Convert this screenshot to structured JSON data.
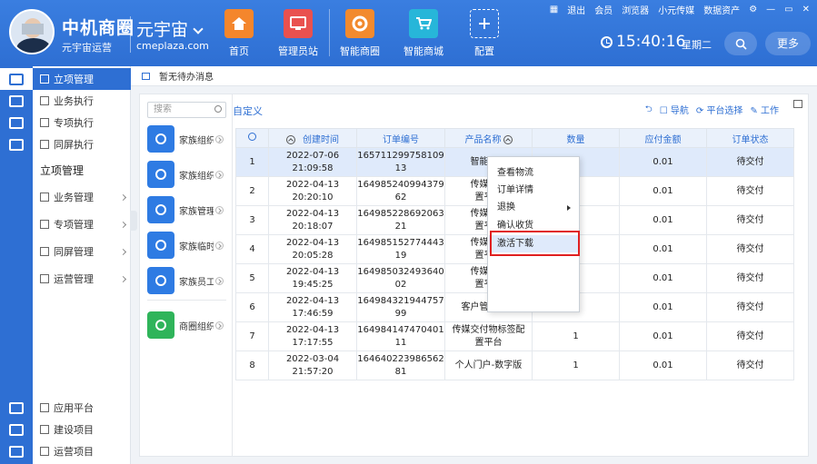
{
  "header": {
    "brand": "中机商圈",
    "brand_sub": "元宇宙运营",
    "workspace": "元宇宙",
    "workspace_url": "cmeplaza.com",
    "nav": [
      {
        "label": "首页",
        "icon": "home-icon"
      },
      {
        "label": "管理员站",
        "icon": "admin-station-icon"
      },
      {
        "label": "智能商圈",
        "icon": "smart-circle-icon"
      },
      {
        "label": "智能商城",
        "icon": "smart-mall-icon"
      },
      {
        "label": "配置",
        "icon": "plus-icon"
      }
    ],
    "toplinks": [
      "退出",
      "会员",
      "浏览器",
      "小元传媒",
      "数据资产"
    ],
    "time": "15:40:16",
    "weekday": "星期二",
    "more": "更多"
  },
  "sidebar": {
    "active": "立项管理",
    "items": [
      "立项管理",
      "业务执行",
      "专项执行",
      "同屏执行"
    ],
    "section": "立项管理",
    "groups": [
      "业务管理",
      "专项管理",
      "同屏管理",
      "运营管理"
    ],
    "bottom": [
      "应用平台",
      "建设项目",
      "运营项目"
    ]
  },
  "notice": "暂无待办消息",
  "orgs": {
    "search_placeholder": "搜索",
    "items": [
      {
        "label": "家族组织",
        "color": "#2e7be3"
      },
      {
        "label": "家族组织",
        "color": "#2e7be3"
      },
      {
        "label": "家族管理",
        "color": "#2e7be3"
      },
      {
        "label": "家族临时",
        "color": "#2e7be3"
      },
      {
        "label": "家族员工",
        "color": "#2e7be3"
      },
      {
        "label": "商圈组织",
        "color": "#2fb45a"
      }
    ]
  },
  "main": {
    "title": "自定义",
    "tools": [
      "导航",
      "平台选择",
      "工作"
    ]
  },
  "table": {
    "headers": [
      "创建时间",
      "订单编号",
      "产品名称",
      "数量",
      "应付金额",
      "订单状态"
    ],
    "rows": [
      {
        "no": "1",
        "date": "2022-07-06",
        "time": "21:09:58",
        "order_a": "165711299758109",
        "order_b": "13",
        "name_a": "智能三宝",
        "name_b": "",
        "qty": "",
        "amount": "0.01",
        "status": "待交付"
      },
      {
        "no": "2",
        "date": "2022-04-13",
        "time": "20:20:10",
        "order_a": "164985240994379",
        "order_b": "62",
        "name_a": "传媒交付",
        "name_b": "置平台",
        "qty": "",
        "amount": "0.01",
        "status": "待交付"
      },
      {
        "no": "3",
        "date": "2022-04-13",
        "time": "20:18:07",
        "order_a": "164985228692063",
        "order_b": "21",
        "name_a": "传媒交付",
        "name_b": "置平台",
        "qty": "",
        "amount": "0.01",
        "status": "待交付"
      },
      {
        "no": "4",
        "date": "2022-04-13",
        "time": "20:05:28",
        "order_a": "164985152774443",
        "order_b": "19",
        "name_a": "传媒交付",
        "name_b": "置平台",
        "qty": "",
        "amount": "0.01",
        "status": "待交付"
      },
      {
        "no": "5",
        "date": "2022-04-13",
        "time": "19:45:25",
        "order_a": "164985032493640",
        "order_b": "02",
        "name_a": "传媒交付",
        "name_b": "置平台",
        "qty": "",
        "amount": "0.01",
        "status": "待交付"
      },
      {
        "no": "6",
        "date": "2022-04-13",
        "time": "17:46:59",
        "order_a": "164984321944757",
        "order_b": "99",
        "name_a": "客户管理平台",
        "name_b": "",
        "qty": "1",
        "amount": "0.01",
        "status": "待交付"
      },
      {
        "no": "7",
        "date": "2022-04-13",
        "time": "17:17:55",
        "order_a": "164984147470401",
        "order_b": "11",
        "name_a": "传媒交付物标签配",
        "name_b": "置平台",
        "qty": "1",
        "amount": "0.01",
        "status": "待交付"
      },
      {
        "no": "8",
        "date": "2022-03-04",
        "time": "21:57:20",
        "order_a": "164640223986562",
        "order_b": "81",
        "name_a": "个人门户-数字版",
        "name_b": "",
        "qty": "1",
        "amount": "0.01",
        "status": "待交付"
      }
    ]
  },
  "context_menu": [
    "查看物流",
    "订单详情",
    "退换",
    "确认收货",
    "激活下载"
  ]
}
